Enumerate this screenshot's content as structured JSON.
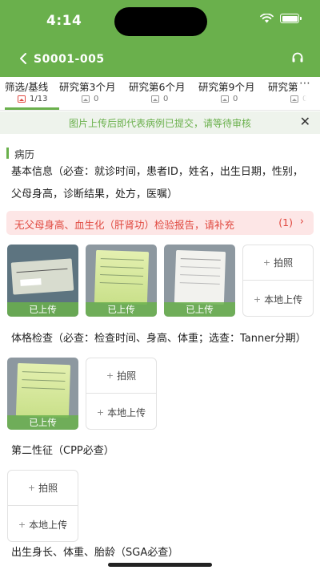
{
  "status_bar": {
    "time": "4:14"
  },
  "nav": {
    "title": "S0001-005",
    "back_icon": "chevron-left-icon",
    "support_icon": "headset-icon"
  },
  "tabs": [
    {
      "label": "筛选/基线",
      "count": "1/13",
      "active": true
    },
    {
      "label": "研究第3个月",
      "count": "0"
    },
    {
      "label": "研究第6个月",
      "count": "0"
    },
    {
      "label": "研究第9个月",
      "count": "0"
    },
    {
      "label": "研究第",
      "count": "0"
    }
  ],
  "notice": {
    "text": "图片上传后即代表病例已提交，请等待审核"
  },
  "section": {
    "title": "病历"
  },
  "basic_info": {
    "line1": "基本信息（必查：就诊时间，患者ID，姓名，出生日期，性别，",
    "line2": "父母身高，诊断结果，处方，医嘱）"
  },
  "warning": {
    "text": "无父母身高、血生化（肝肾功）检验报告，请补充",
    "count": "(1)"
  },
  "photo_status": "已上传",
  "upload": {
    "camera_label": "拍照",
    "local_label": "本地上传"
  },
  "physical_exam": {
    "title": "体格检查（必查：检查时间、身高、体重；选查：Tanner分期）"
  },
  "secondary_sex": {
    "title": "第二性征（CPP必查）"
  },
  "birth_info": {
    "title": "出生身长、体重、胎龄（SGA必查）"
  },
  "colors": {
    "brand": "#6ab04c",
    "warning": "#e0483f",
    "warning_bg": "#fde6e6",
    "notice_bg": "#eef3ec"
  }
}
